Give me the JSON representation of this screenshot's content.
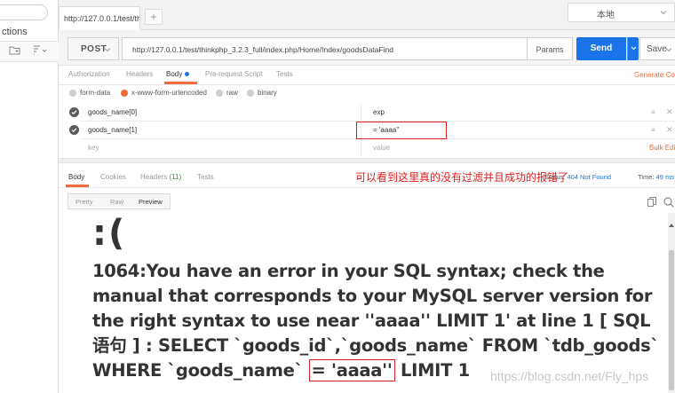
{
  "sidebar": {
    "label": "ctions"
  },
  "tabs": [
    {
      "label": "http://127.0.0.1/test/thir"
    }
  ],
  "tab_add": "+",
  "environment": {
    "selected": "本地"
  },
  "request": {
    "method": "POST",
    "url": "http://127.0.0.1/test/thinkphp_3.2.3_full/index.php/Home/Index/goodsDataFind",
    "params_label": "Params",
    "send_label": "Send",
    "save_label": "Save"
  },
  "request_tabs": {
    "authorization": "Authorization",
    "headers": "Headers",
    "body": "Body",
    "prerequest": "Pre-request Script",
    "tests": "Tests",
    "generate_code": "Generate Cod"
  },
  "body_types": {
    "form_data": "form-data",
    "urlencoded": "x-www-form-urlencoded",
    "raw": "raw",
    "binary": "binary",
    "selected": "x-www-form-urlencoded"
  },
  "kv_rows": [
    {
      "key": "goods_name[0]",
      "value": "exp"
    },
    {
      "key": "goods_name[1]",
      "value": "= 'aaaa''"
    }
  ],
  "kv_placeholder": {
    "key": "key",
    "value": "value",
    "bulk_edit": "Bulk Edi"
  },
  "response_tabs": {
    "body": "Body",
    "cookies": "Cookies",
    "headers": "Headers",
    "headers_count": "(11)",
    "tests": "Tests"
  },
  "annotation": "可以看到这里真的没有过滤并且成功的报错了",
  "status": {
    "label": "Status:",
    "value": "404 Not Found"
  },
  "time": {
    "label": "Time:",
    "value": "49 ms"
  },
  "view_modes": {
    "pretty": "Pretty",
    "raw": "Raw",
    "preview": "Preview",
    "selected": "Preview"
  },
  "preview": {
    "sad_face": ":(",
    "error_part1": "1064:You have an error in your SQL syntax; check the manual that corresponds to your MySQL server version for the right syntax to use near ''aaaa'' LIMIT 1' at line 1 [ SQL语句 ] : SELECT `goods_id`,`goods_name` FROM `tdb_goods` WHERE `goods_name` ",
    "error_highlight": "= 'aaaa''",
    "error_part2": " LIMIT 1"
  },
  "watermark": "https://blog.csdn.net/Fly_hps",
  "colors": {
    "accent": "#f26b3a",
    "send": "#1a73e8",
    "annotation": "#e02020"
  }
}
